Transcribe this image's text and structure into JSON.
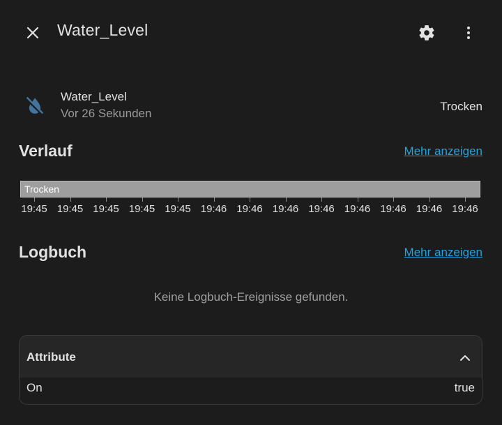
{
  "dialog": {
    "title": "Water_Level",
    "icons": {
      "close": "close-icon",
      "settings": "gear-icon",
      "menu": "dots-vertical-icon"
    }
  },
  "entity": {
    "icon": "water-off-icon",
    "icon_color": "#44739e",
    "name": "Water_Level",
    "last_changed": "Vor 26 Sekunden",
    "state": "Trocken"
  },
  "history": {
    "title": "Verlauf",
    "more_link": "Mehr anzeigen",
    "bar_label": "Trocken",
    "bar_color": "#9e9e9e",
    "ticks": [
      "19:45",
      "19:45",
      "19:45",
      "19:45",
      "19:45",
      "19:46",
      "19:46",
      "19:46",
      "19:46",
      "19:46",
      "19:46",
      "19:46",
      "19:46"
    ]
  },
  "logbook": {
    "title": "Logbuch",
    "more_link": "Mehr anzeigen",
    "empty_message": "Keine Logbuch-Ereignisse gefunden."
  },
  "attributes": {
    "title": "Attribute",
    "expanded": true,
    "rows": [
      {
        "key": "On",
        "value": "true"
      }
    ]
  },
  "colors": {
    "background": "#1c1c1c",
    "accent_link": "#1ea3e0",
    "primary_text": "#e1e1e1",
    "secondary_text": "#9b9b9b"
  }
}
